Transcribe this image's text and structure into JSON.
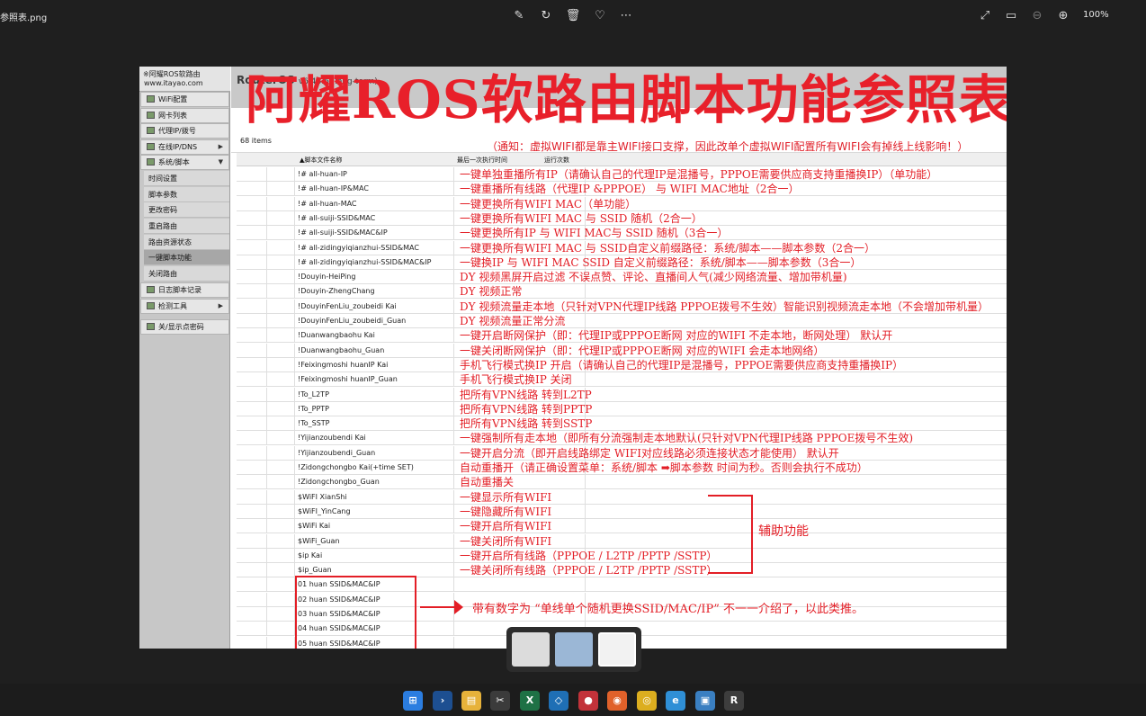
{
  "viewer": {
    "file_name": "参照表.png",
    "zoom_level": "100%",
    "toolbar_icons": [
      "edit-icon",
      "rotate-icon",
      "delete-icon",
      "favorite-icon",
      "more-icon",
      "fullscreen-icon",
      "fit-icon",
      "zoom-out-icon",
      "zoom-in-icon"
    ]
  },
  "ros": {
    "brand_line1": "※阿耀ROS软路由",
    "brand_line2": "www.itayao.com",
    "title": "RouterOS",
    "version": "v6.48.6 (long-term)",
    "menu": [
      {
        "label": "WiFi配置",
        "arrow": ""
      },
      {
        "label": "网卡列表",
        "arrow": ""
      },
      {
        "label": "代理IP/拨号",
        "arrow": ""
      },
      {
        "label": "在线IP/DNS",
        "arrow": "▶"
      },
      {
        "label": "系统/脚本",
        "arrow": "▼"
      }
    ],
    "submenu": [
      "时间设置",
      "脚本参数",
      "更改密码",
      "重启路由",
      "路由资源状态",
      "一键脚本功能",
      "关闭路由"
    ],
    "menu_bottom": [
      {
        "label": "日志脚本记录",
        "arrow": ""
      },
      {
        "label": "检测工具",
        "arrow": "▶"
      },
      {
        "label": "关/显示点密码",
        "arrow": ""
      }
    ],
    "items_count": "68 items",
    "columns": [
      "▲脚本文件名称",
      "最后一次执行时间",
      "运行次数"
    ]
  },
  "page_title": "阿耀ROS软路由脚本功能参照表",
  "notice": "（通知：虚拟WIFI都是靠主WIFI接口支撑，因此改单个虚拟WIFI配置所有WIFI会有掉线上线影响！）",
  "rows": [
    {
      "name": "!# all-huan-IP",
      "note": "一键单独重播所有IP（请确认自己的代理IP是混播号，PPPOE需要供应商支持重播换IP）（单功能）"
    },
    {
      "name": "!# all-huan-IP&MAC",
      "note": "一键重播所有线路（代理IP &PPPOE） 与 WIFI MAC地址（2合一）"
    },
    {
      "name": "!# all-huan-MAC",
      "note": "一键更换所有WIFI MAC（单功能）"
    },
    {
      "name": "!# all-suiji-SSID&MAC",
      "note": "一键更换所有WIFI MAC 与 SSID 随机（2合一）"
    },
    {
      "name": "!# all-suiji-SSID&MAC&IP",
      "note": "一键更换所有IP 与 WIFI MAC与 SSID 随机（3合一）"
    },
    {
      "name": "!# all-zidingyiqianzhui-SSID&MAC",
      "note": "一键更换所有WIFI MAC 与 SSID自定义前缀路径：系统/脚本——脚本参数（2合一）"
    },
    {
      "name": "!# all-zidingyiqianzhui-SSID&MAC&IP",
      "note": "一键换IP 与 WIFI MAC SSID 自定义前缀路径：系统/脚本——脚本参数（3合一）"
    },
    {
      "name": "!Douyin-HeiPing",
      "note": "DY 视频黑屏开启过滤 不误点赞、评论、直播间人气(减少网络流量、增加带机量)"
    },
    {
      "name": "!Douyin-ZhengChang",
      "note": "DY 视频正常"
    },
    {
      "name": "!DouyinFenLiu_zoubeidi Kai",
      "note": "DY 视频流量走本地（只针对VPN代理IP线路 PPPOE拨号不生效）智能识别视频流走本地（不会增加带机量）"
    },
    {
      "name": "!DouyinFenLiu_zoubeidi_Guan",
      "note": "DY 视频流量正常分流"
    },
    {
      "name": "!Duanwangbaohu Kai",
      "note": "一键开启断网保护（即：代理IP或PPPOE断网 对应的WIFI 不走本地，断网处理） 默认开"
    },
    {
      "name": "!Duanwangbaohu_Guan",
      "note": "一键关闭断网保护（即：代理IP或PPPOE断网 对应的WIFI 会走本地网络）"
    },
    {
      "name": "!Feixingmoshi huanIP Kai",
      "note": "手机飞行模式换IP 开启（请确认自己的代理IP是混播号，PPPOE需要供应商支持重播换IP）"
    },
    {
      "name": "!Feixingmoshi huanIP_Guan",
      "note": "手机飞行模式换IP 关闭"
    },
    {
      "name": "!To_L2TP",
      "note": "把所有VPN线路 转到L2TP"
    },
    {
      "name": "!To_PPTP",
      "note": "把所有VPN线路 转到PPTP"
    },
    {
      "name": "!To_SSTP",
      "note": "把所有VPN线路 转到SSTP"
    },
    {
      "name": "!Yijianzoubendi Kai",
      "note": "一键强制所有走本地（即所有分流强制走本地默认(只针对VPN代理IP线路 PPPOE拨号不生效)"
    },
    {
      "name": "!Yijianzoubendi_Guan",
      "note": "一键开启分流（即开启线路绑定 WIFI对应线路必须连接状态才能使用） 默认开"
    },
    {
      "name": "!Zidongchongbo Kai(+time SET)",
      "note": "自动重播开（请正确设置菜单：系统/脚本 ➡脚本参数 时间为秒。否则会执行不成功）"
    },
    {
      "name": "!Zidongchongbo_Guan",
      "note": "自动重播关"
    },
    {
      "name": "$WiFI XianShi",
      "note": "一键显示所有WIFI"
    },
    {
      "name": "$WiFI_YinCang",
      "note": "一键隐藏所有WIFI"
    },
    {
      "name": "$WiFi Kai",
      "note": "一键开启所有WIFI"
    },
    {
      "name": "$WiFi_Guan",
      "note": "一键关闭所有WIFI"
    },
    {
      "name": "$ip Kai",
      "note": "一键开启所有线路（PPPOE / L2TP /PPTP /SSTP）"
    },
    {
      "name": "$ip_Guan",
      "note": "一键关闭所有线路（PPPOE / L2TP /PPTP /SSTP）"
    },
    {
      "name": "01 huan SSID&MAC&IP",
      "note": ""
    },
    {
      "name": "02 huan SSID&MAC&IP",
      "note": ""
    },
    {
      "name": "03 huan SSID&MAC&IP",
      "note": ""
    },
    {
      "name": "04 huan SSID&MAC&IP",
      "note": ""
    },
    {
      "name": "05 huan SSID&MAC&IP",
      "note": ""
    }
  ],
  "aux_label": "辅助功能",
  "num_note": "带有数字为 “单线单个随机更换SSID/MAC/IP” 不一一介绍了，以此类推。",
  "taskbar_icons": [
    "windows-start-icon",
    "powershell-icon",
    "file-explorer-icon",
    "snipping-tool-icon",
    "excel-icon",
    "vscode-icon",
    "app-icon",
    "firefox-icon",
    "chrome-icon",
    "edge-icon",
    "photos-icon",
    "winbox-icon"
  ]
}
